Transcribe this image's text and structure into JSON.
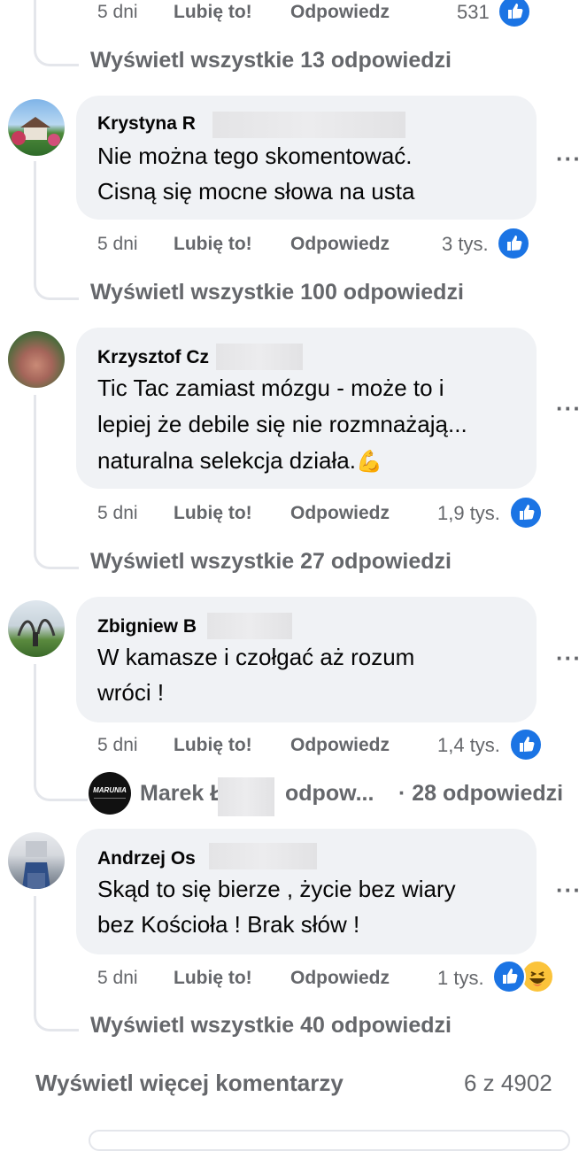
{
  "top_partial": {
    "time": "5 dni",
    "like_label": "Lubię to!",
    "reply_label": "Odpowiedz",
    "reactions_count": "531",
    "view_replies": "Wyświetl wszystkie 13 odpowiedzi"
  },
  "comments": [
    {
      "author": "Krystyna R",
      "lines": [
        "Nie można tego skomentować.",
        "Cisną się mocne słowa na usta"
      ],
      "time": "5 dni",
      "like_label": "Lubię to!",
      "reply_label": "Odpowiedz",
      "reactions_count": "3 tys.",
      "view_replies": "Wyświetl wszystkie 100 odpowiedzi"
    },
    {
      "author": "Krzysztof Cz",
      "lines": [
        "Tic Tac zamiast mózgu - może to i",
        "lepiej że debile się nie rozmnażają...",
        "naturalna selekcja działa."
      ],
      "emoji": "💪",
      "time": "5 dni",
      "like_label": "Lubię to!",
      "reply_label": "Odpowiedz",
      "reactions_count": "1,9 tys.",
      "view_replies": "Wyświetl wszystkie 27 odpowiedzi"
    },
    {
      "author": "Zbigniew B",
      "lines": [
        "W kamasze i czołgać aż rozum",
        "wróci !"
      ],
      "time": "5 dni",
      "like_label": "Lubię to!",
      "reply_label": "Odpowiedz",
      "reactions_count": "1,4 tys.",
      "reply_preview": {
        "avatar_text": "MARUNIA",
        "author": "Marek Ł",
        "snippet": "odpow...",
        "count": "· 28 odpowiedzi"
      }
    },
    {
      "author": "Andrzej Os",
      "lines": [
        "Skąd to się bierze , życie bez wiary",
        "bez Kościoła ! Brak słów !"
      ],
      "time": "5 dni",
      "like_label": "Lubię to!",
      "reply_label": "Odpowiedz",
      "reactions_count": "1 tys.",
      "view_replies": "Wyświetl wszystkie 40 odpowiedzi"
    }
  ],
  "footer": {
    "view_more": "Wyświetl więcej komentarzy",
    "counter": "6 z 4902"
  },
  "icons": {
    "like": "like-icon",
    "haha": "haha-icon",
    "more": "more-options-icon"
  },
  "colors": {
    "like_blue": "#1b74e4",
    "bubble_bg": "#f0f2f5",
    "muted_text": "#65676b"
  }
}
